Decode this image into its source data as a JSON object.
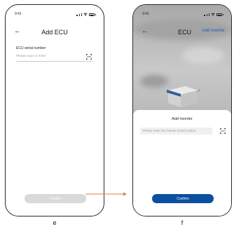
{
  "colors": {
    "accent": "#0b4fa0",
    "disabled_button": "#d9d9d9",
    "link": "#1f5bb5",
    "arrow": "#e07a48"
  },
  "screen_e": {
    "status_time": "9:41",
    "back_icon": "back-arrow-icon",
    "title": "Add ECU",
    "field_label": "ECU serial number",
    "field_placeholder": "Please scan or enter",
    "scan_icon": "scan-icon",
    "confirm_label": "Confirm",
    "confirm_enabled": false,
    "caption": "e"
  },
  "screen_f": {
    "status_time": "9:41",
    "back_icon": "back-arrow-icon",
    "title": "ECU",
    "nav_action": "Add inverter",
    "sheet_title": "Add inverter",
    "sheet_placeholder": "Please enter the inverter serial number",
    "scan_icon": "scan-icon",
    "confirm_label": "Confirm",
    "confirm_enabled": true,
    "caption": "f"
  },
  "connector_icon": "arrow-right-icon"
}
